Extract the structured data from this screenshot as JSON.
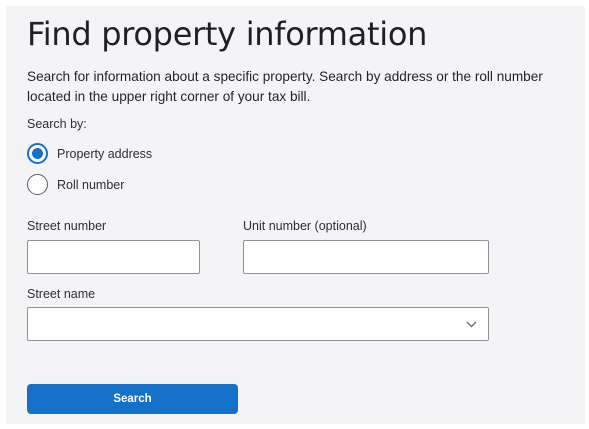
{
  "header": {
    "title": "Find property information",
    "description": "Search for information about a specific property. Search by address or the roll number located in the upper right corner of your tax bill."
  },
  "search_by": {
    "label": "Search by:",
    "options": [
      {
        "label": "Property address",
        "selected": true
      },
      {
        "label": "Roll number",
        "selected": false
      }
    ]
  },
  "fields": {
    "street_number": {
      "label": "Street number",
      "value": "",
      "placeholder": ""
    },
    "unit_number": {
      "label": "Unit number (optional)",
      "value": "",
      "placeholder": ""
    },
    "street_name": {
      "label": "Street name",
      "selected_value": ""
    }
  },
  "actions": {
    "search_label": "Search"
  },
  "icons": {
    "street_name_dropdown": "chevron-down-icon"
  },
  "colors": {
    "accent": "#1570c9",
    "panel_background": "#f4f4f7"
  }
}
